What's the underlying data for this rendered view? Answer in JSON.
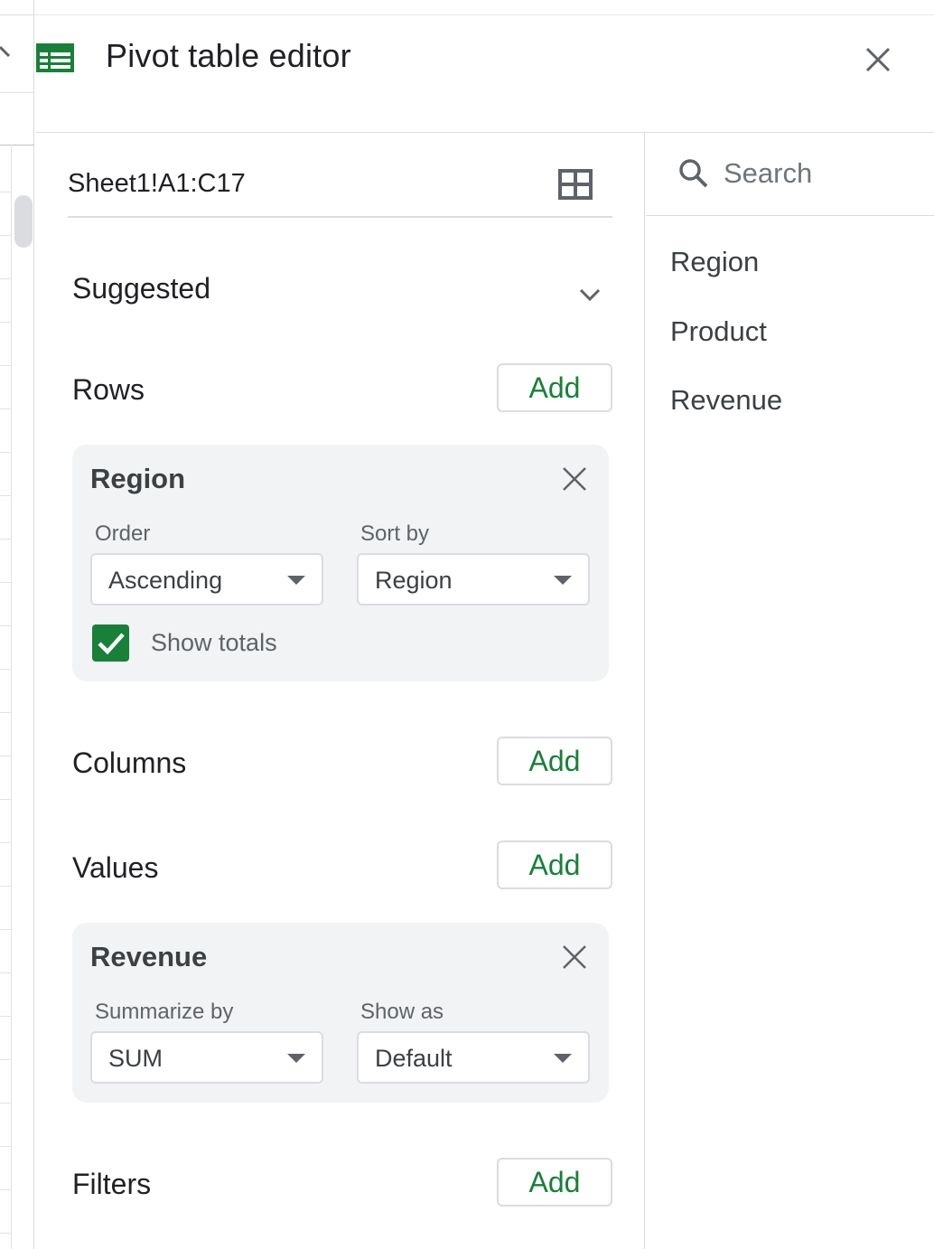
{
  "header": {
    "title": "Pivot table editor"
  },
  "config": {
    "range": "Sheet1!A1:C17",
    "suggested_label": "Suggested",
    "rows": {
      "label": "Rows",
      "add_label": "Add",
      "card": {
        "title": "Region",
        "order_label": "Order",
        "order_value": "Ascending",
        "sortby_label": "Sort by",
        "sortby_value": "Region",
        "show_totals_label": "Show totals",
        "show_totals_checked": true
      }
    },
    "columns": {
      "label": "Columns",
      "add_label": "Add"
    },
    "values": {
      "label": "Values",
      "add_label": "Add",
      "card": {
        "title": "Revenue",
        "summarize_label": "Summarize by",
        "summarize_value": "SUM",
        "showas_label": "Show as",
        "showas_value": "Default"
      }
    },
    "filters": {
      "label": "Filters",
      "add_label": "Add"
    }
  },
  "fields": {
    "search_placeholder": "Search",
    "items": [
      "Region",
      "Product",
      "Revenue"
    ]
  },
  "colors": {
    "accent_green": "#188038",
    "card_bg": "#f1f3f4",
    "border": "#dadce0"
  }
}
